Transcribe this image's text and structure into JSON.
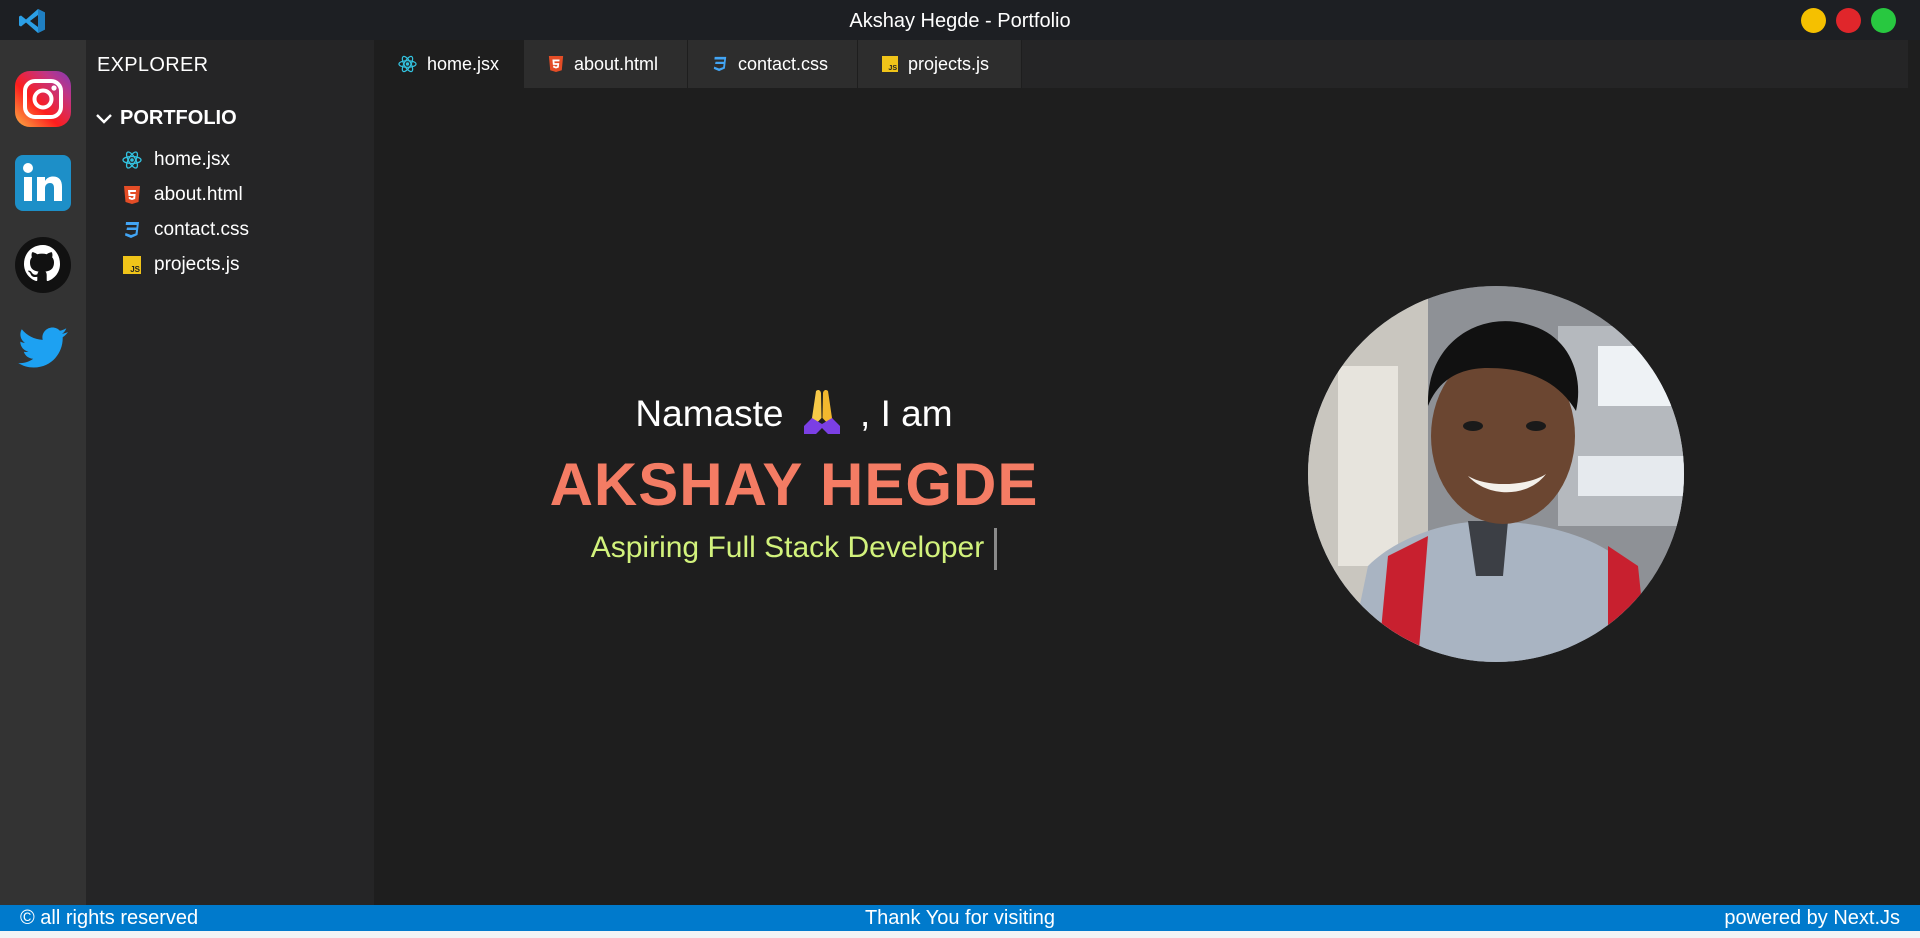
{
  "window": {
    "title": "Akshay Hegde - Portfolio",
    "controls": [
      {
        "name": "minimize",
        "color": "#f5c000"
      },
      {
        "name": "close",
        "color": "#e0262b"
      },
      {
        "name": "maximize",
        "color": "#28c840"
      }
    ]
  },
  "activity_bar": {
    "items": [
      {
        "icon": "instagram-icon"
      },
      {
        "icon": "linkedin-icon"
      },
      {
        "icon": "github-icon"
      },
      {
        "icon": "twitter-icon"
      }
    ]
  },
  "explorer": {
    "heading": "EXPLORER",
    "folder": "PORTFOLIO",
    "files": [
      {
        "label": "home.jsx",
        "icon": "react-icon"
      },
      {
        "label": "about.html",
        "icon": "html5-icon"
      },
      {
        "label": "contact.css",
        "icon": "css3-icon"
      },
      {
        "label": "projects.js",
        "icon": "js-icon"
      }
    ]
  },
  "tabs": [
    {
      "label": "home.jsx",
      "icon": "react-icon",
      "active": true
    },
    {
      "label": "about.html",
      "icon": "html5-icon",
      "active": false
    },
    {
      "label": "contact.css",
      "icon": "css3-icon",
      "active": false
    },
    {
      "label": "projects.js",
      "icon": "js-icon",
      "active": false
    }
  ],
  "hero": {
    "greeting_start": "Namaste",
    "greeting_emoji": "folded-hands-icon",
    "greeting_end": ", I am",
    "name": "AKSHAY HEGDE",
    "role": "Aspiring Full Stack Developer",
    "photo": "profile-photo"
  },
  "statusbar": {
    "left": "© all rights reserved",
    "center": "Thank You for visiting",
    "right": "powered by Next.Js"
  },
  "colors": {
    "accent": "#007acc",
    "name": "#f47c64",
    "role": "#d2f27c"
  }
}
